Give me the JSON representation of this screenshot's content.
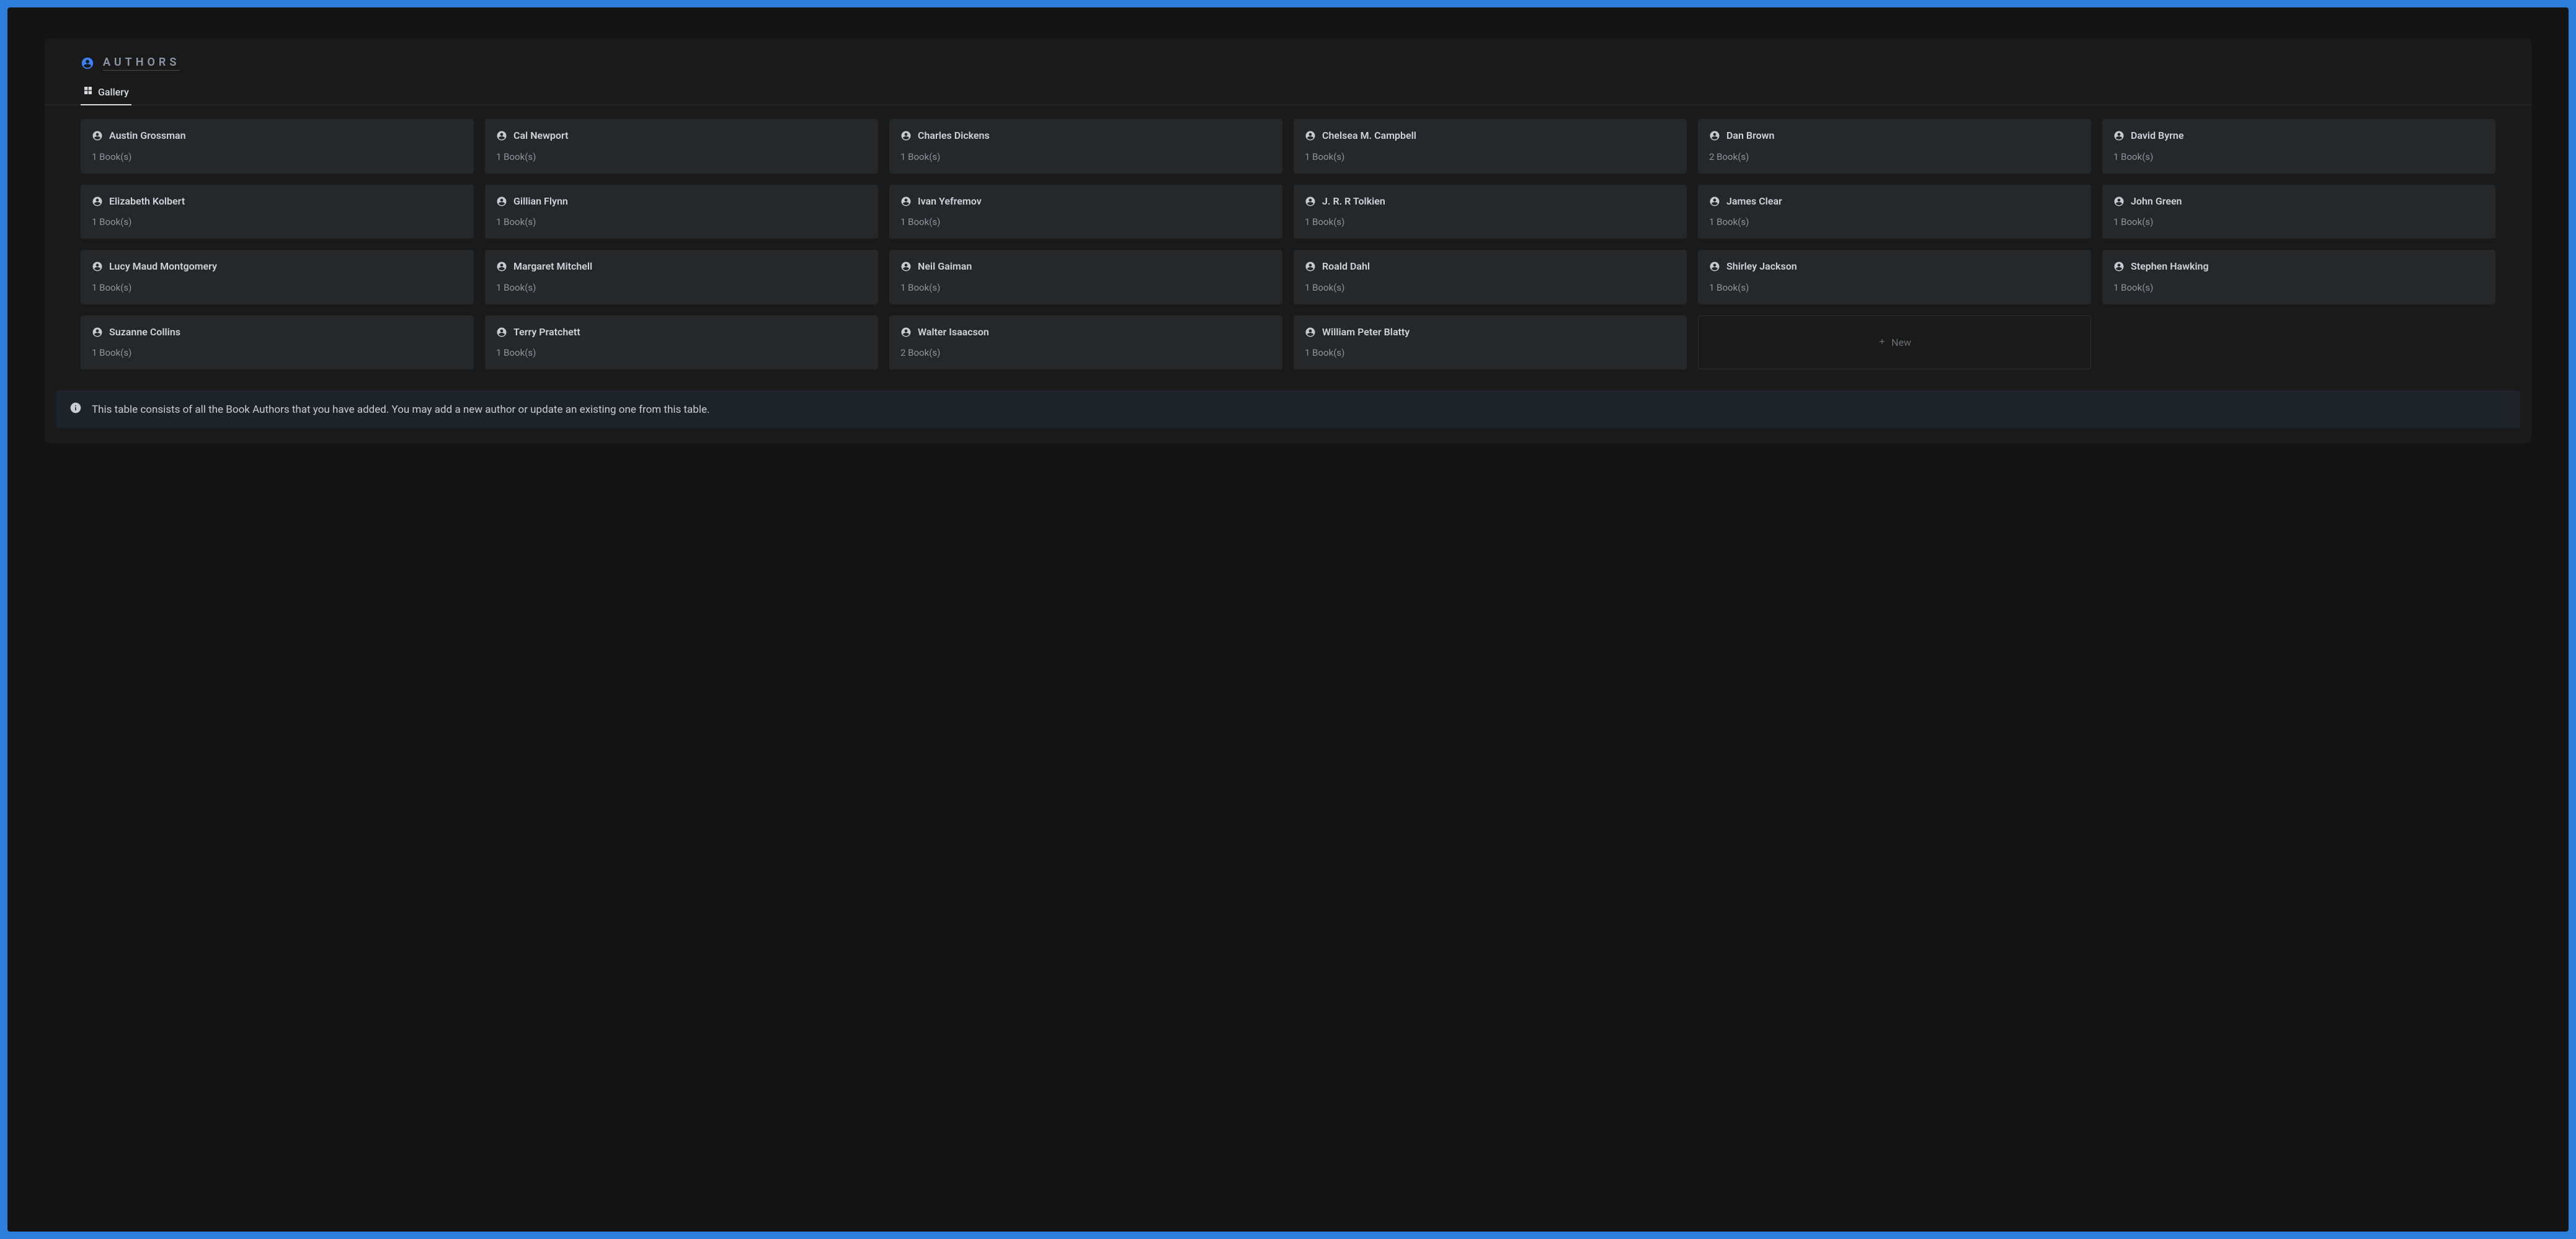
{
  "header": {
    "title": "AUTHORS"
  },
  "tabs": {
    "active": {
      "label": "Gallery"
    }
  },
  "authors": [
    {
      "name": "Austin Grossman",
      "books": "1 Book(s)"
    },
    {
      "name": "Cal Newport",
      "books": "1 Book(s)"
    },
    {
      "name": "Charles Dickens",
      "books": "1 Book(s)"
    },
    {
      "name": "Chelsea M. Campbell",
      "books": "1 Book(s)"
    },
    {
      "name": "Dan Brown",
      "books": "2 Book(s)"
    },
    {
      "name": "David Byrne",
      "books": "1 Book(s)"
    },
    {
      "name": "Elizabeth Kolbert",
      "books": "1 Book(s)"
    },
    {
      "name": "Gillian Flynn",
      "books": "1 Book(s)"
    },
    {
      "name": "Ivan Yefremov",
      "books": "1 Book(s)"
    },
    {
      "name": "J. R. R Tolkien",
      "books": "1 Book(s)"
    },
    {
      "name": "James Clear",
      "books": "1 Book(s)"
    },
    {
      "name": "John Green",
      "books": "1 Book(s)"
    },
    {
      "name": "Lucy Maud Montgomery",
      "books": "1 Book(s)"
    },
    {
      "name": "Margaret Mitchell",
      "books": "1 Book(s)"
    },
    {
      "name": "Neil Gaiman",
      "books": "1 Book(s)"
    },
    {
      "name": "Roald Dahl",
      "books": "1 Book(s)"
    },
    {
      "name": "Shirley Jackson",
      "books": "1 Book(s)"
    },
    {
      "name": "Stephen Hawking",
      "books": "1 Book(s)"
    },
    {
      "name": "Suzanne Collins",
      "books": "1 Book(s)"
    },
    {
      "name": "Terry Pratchett",
      "books": "1 Book(s)"
    },
    {
      "name": "Walter Isaacson",
      "books": "2 Book(s)"
    },
    {
      "name": "William Peter Blatty",
      "books": "1 Book(s)"
    }
  ],
  "newCard": {
    "label": "New"
  },
  "info": {
    "text": "This table consists of all the Book Authors that you have added. You may add a new author or update an existing one from this table."
  }
}
